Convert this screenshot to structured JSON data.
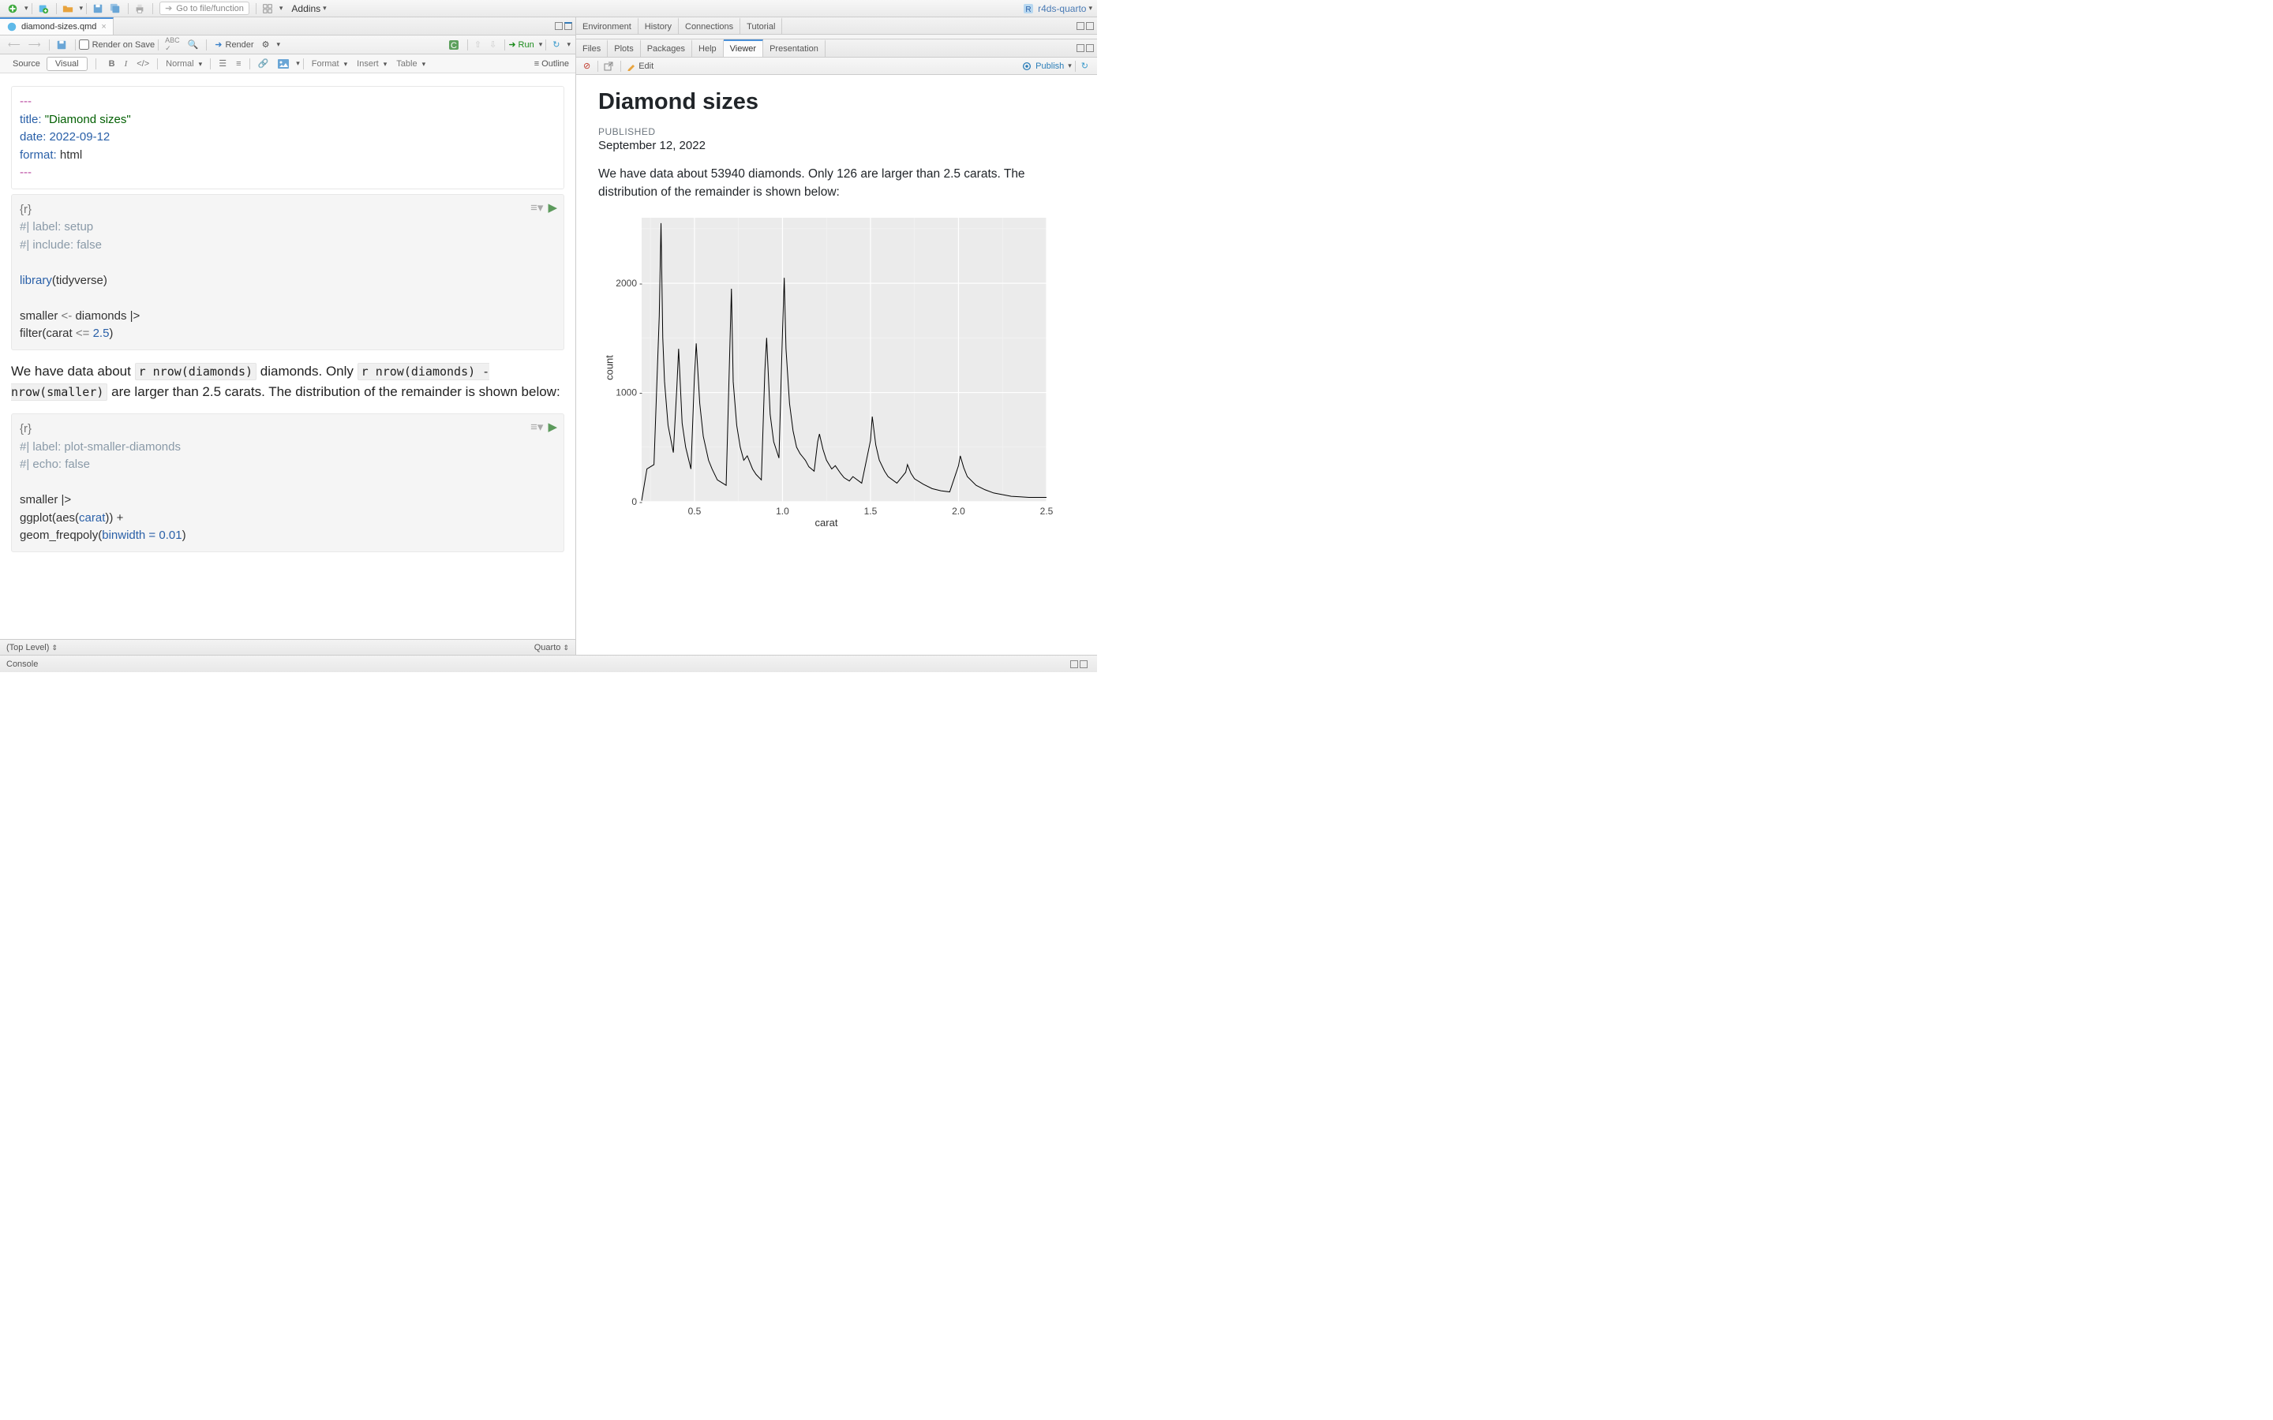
{
  "project_name": "r4ds-quarto",
  "top_toolbar": {
    "goto_placeholder": "Go to file/function",
    "addins_label": "Addins"
  },
  "editor_tab": {
    "filename": "diamond-sizes.qmd"
  },
  "editor_toolbar": {
    "render_on_save": "Render on Save",
    "render": "Render",
    "run": "Run",
    "outline": "Outline"
  },
  "editor_toolbar2": {
    "source": "Source",
    "visual": "Visual",
    "normal": "Normal",
    "format": "Format",
    "insert": "Insert",
    "table": "Table"
  },
  "yaml": {
    "title_key": "title:",
    "title_val": "\"Diamond sizes\"",
    "date_key": "date:",
    "date_val": "2022-09-12",
    "format_key": "format:",
    "format_val": "html"
  },
  "chunk1": {
    "header": "{r}",
    "opt1": "#| label: setup",
    "opt2": "#| include: false",
    "line1a": "library",
    "line1b": "(tidyverse)",
    "line2a": "smaller ",
    "line2b": "<-",
    "line2c": " diamonds |>",
    "line3a": "  filter(carat ",
    "line3b": "<=",
    "line3c": " ",
    "line3d": "2.5",
    "line3e": ")"
  },
  "prose": {
    "p1a": "We have data about ",
    "inline1": "r nrow(diamonds)",
    "p1b": " diamonds. Only ",
    "inline2": "r nrow(diamonds) - nrow(smaller)",
    "p1c": " are larger than 2.5 carats. The distribution of the remainder is shown below:"
  },
  "chunk2": {
    "header": "{r}",
    "opt1": "#| label: plot-smaller-diamonds",
    "opt2": "#| echo: false",
    "line1": "smaller |>",
    "line2a": "  ggplot(aes(",
    "line2b": "carat",
    "line2c": ")) +",
    "line3a": "  geom_freqpoly(",
    "line3b": "binwidth = ",
    "line3c": "0.01",
    "line3d": ")"
  },
  "status_bar": {
    "left": "(Top Level)",
    "right": "Quarto"
  },
  "console_label": "Console",
  "right_top_tabs": [
    "Environment",
    "History",
    "Connections",
    "Tutorial"
  ],
  "right_bottom_tabs": [
    "Files",
    "Plots",
    "Packages",
    "Help",
    "Viewer",
    "Presentation"
  ],
  "viewer_toolbar": {
    "edit": "Edit",
    "publish": "Publish"
  },
  "viewer": {
    "title": "Diamond sizes",
    "pub_label": "PUBLISHED",
    "pub_date": "September 12, 2022",
    "text": "We have data about 53940 diamonds. Only 126 are larger than 2.5 carats. The distribution of the remainder is shown below:"
  },
  "chart_data": {
    "type": "line",
    "title": "",
    "xlabel": "carat",
    "ylabel": "count",
    "xlim": [
      0.2,
      2.5
    ],
    "ylim": [
      0,
      2600
    ],
    "x_ticks": [
      0.5,
      1.0,
      1.5,
      2.0,
      2.5
    ],
    "y_ticks": [
      0,
      1000,
      2000
    ],
    "series": [
      {
        "name": "count",
        "x": [
          0.2,
          0.23,
          0.25,
          0.27,
          0.3,
          0.31,
          0.32,
          0.33,
          0.35,
          0.38,
          0.4,
          0.41,
          0.43,
          0.45,
          0.48,
          0.5,
          0.51,
          0.53,
          0.55,
          0.58,
          0.6,
          0.63,
          0.65,
          0.68,
          0.7,
          0.71,
          0.72,
          0.74,
          0.76,
          0.78,
          0.8,
          0.83,
          0.85,
          0.88,
          0.9,
          0.91,
          0.93,
          0.95,
          0.98,
          1.0,
          1.01,
          1.02,
          1.04,
          1.06,
          1.08,
          1.1,
          1.13,
          1.15,
          1.18,
          1.2,
          1.21,
          1.23,
          1.25,
          1.28,
          1.3,
          1.33,
          1.35,
          1.38,
          1.4,
          1.45,
          1.5,
          1.51,
          1.53,
          1.55,
          1.58,
          1.6,
          1.65,
          1.7,
          1.71,
          1.73,
          1.75,
          1.8,
          1.85,
          1.9,
          1.95,
          2.0,
          2.01,
          2.03,
          2.05,
          2.1,
          2.15,
          2.2,
          2.25,
          2.3,
          2.35,
          2.4,
          2.45,
          2.5
        ],
        "values": [
          10,
          300,
          320,
          340,
          1700,
          2550,
          1500,
          1100,
          700,
          450,
          1050,
          1400,
          720,
          500,
          300,
          1150,
          1450,
          900,
          600,
          380,
          300,
          200,
          180,
          150,
          1350,
          1950,
          1100,
          700,
          500,
          380,
          420,
          300,
          250,
          200,
          1200,
          1500,
          800,
          550,
          400,
          1550,
          2050,
          1400,
          900,
          650,
          500,
          440,
          380,
          320,
          280,
          550,
          620,
          480,
          380,
          300,
          330,
          260,
          220,
          190,
          230,
          170,
          560,
          780,
          520,
          380,
          280,
          230,
          170,
          270,
          340,
          260,
          210,
          160,
          120,
          100,
          90,
          330,
          420,
          310,
          230,
          150,
          110,
          80,
          65,
          50,
          45,
          40,
          40,
          40
        ]
      }
    ]
  }
}
